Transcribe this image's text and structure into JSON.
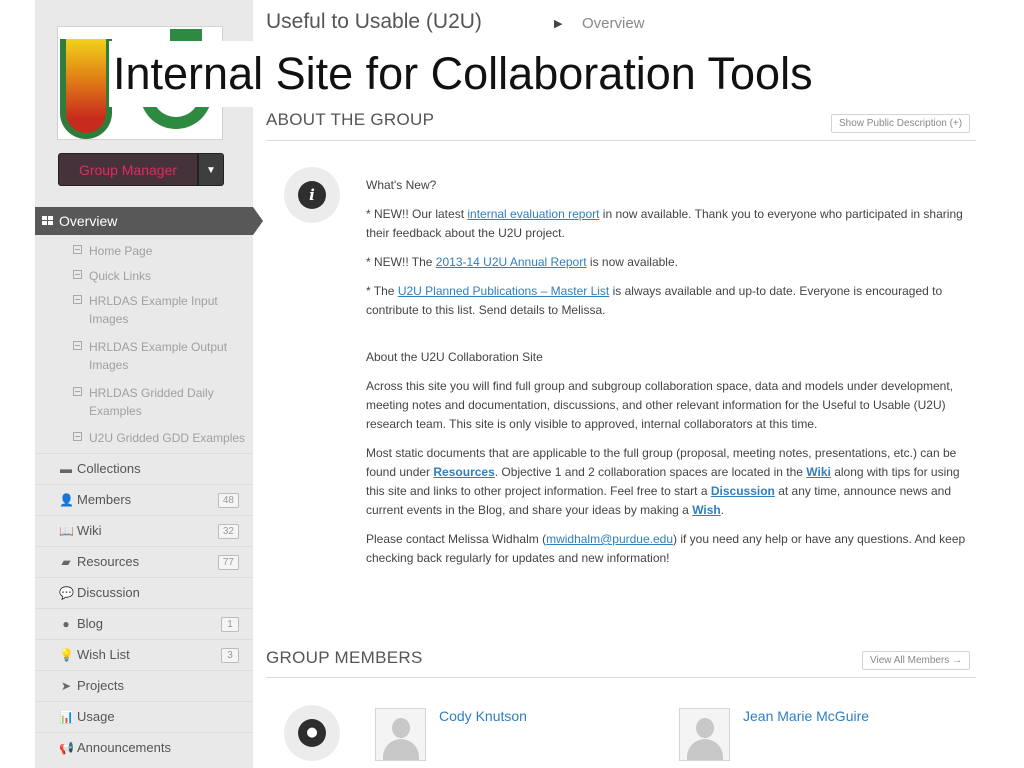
{
  "caption": "Internal Site for Collaboration Tools",
  "breadcrumb": {
    "title": "Useful to Usable (U2U)",
    "current": "Overview"
  },
  "sidebar": {
    "group_manager": "Group Manager",
    "overview": "Overview",
    "subpages": [
      "Home Page",
      "Quick Links",
      "HRLDAS Example Input Images",
      "HRLDAS Example Output Images",
      "HRLDAS Gridded Daily Examples",
      "U2U Gridded GDD Examples"
    ],
    "items": [
      {
        "label": "Collections",
        "icon": "collections-icon",
        "glyph": "▬",
        "count": ""
      },
      {
        "label": "Members",
        "icon": "members-icon",
        "glyph": "👤",
        "count": "48"
      },
      {
        "label": "Wiki",
        "icon": "wiki-icon",
        "glyph": "📖",
        "count": "32"
      },
      {
        "label": "Resources",
        "icon": "resources-icon",
        "glyph": "▰",
        "count": "77"
      },
      {
        "label": "Discussion",
        "icon": "discussion-icon",
        "glyph": "💬",
        "count": ""
      },
      {
        "label": "Blog",
        "icon": "blog-icon",
        "glyph": "●",
        "count": "1"
      },
      {
        "label": "Wish List",
        "icon": "lightbulb-icon",
        "glyph": "💡",
        "count": "3"
      },
      {
        "label": "Projects",
        "icon": "projects-icon",
        "glyph": "➤",
        "count": ""
      },
      {
        "label": "Usage",
        "icon": "usage-icon",
        "glyph": "📊",
        "count": ""
      },
      {
        "label": "Announcements",
        "icon": "announcements-icon",
        "glyph": "📢",
        "count": ""
      }
    ]
  },
  "about": {
    "heading": "ABOUT THE GROUP",
    "show_public": "Show Public Description (+)",
    "whats_new": "What's New?",
    "news1_pre": "* NEW!! Our latest ",
    "news1_link": "internal evaluation report",
    "news1_post": " in now available. Thank you to everyone who participated in sharing their feedback about the U2U project.",
    "news2_pre": "* NEW!! The ",
    "news2_link": "2013-14 U2U Annual Report",
    "news2_post": " is now available.",
    "news3_pre": "* The ",
    "news3_link": "U2U Planned Publications – Master List",
    "news3_post": " is always available and up-to date. Everyone is encouraged to contribute to this list. Send details to Melissa.",
    "site_heading": "About the U2U Collaboration Site",
    "para1": "Across this site you will find full group and subgroup collaboration space, data and models under development, meeting notes and documentation, discussions, and other relevant information for the Useful to Usable (U2U) research team. This site is only visible to approved, internal collaborators at this time.",
    "para2_a": "Most static documents that are applicable to the full group (proposal, meeting notes, presentations, etc.) can be found under ",
    "para2_resources": "Resources",
    "para2_b": ". Objective 1 and 2 collaboration spaces are located in the ",
    "para2_wiki": "Wiki",
    "para2_c": " along with tips for using this site and links to other project information. Feel free to start a ",
    "para2_discussion": "Discussion",
    "para2_d": " at any time, announce news and current events in the Blog, and share your ideas by making a ",
    "para2_wish": "Wish",
    "para2_e": ".",
    "para3_a": "Please contact Melissa Widhalm (",
    "para3_email": "mwidhalm@purdue.edu",
    "para3_b": ") if you need any help or have any questions. And keep checking back regularly for updates and new information!"
  },
  "members": {
    "heading": "GROUP MEMBERS",
    "view_all": "View All Members →",
    "list": [
      "Cody Knutson",
      "Jean Marie McGuire"
    ]
  }
}
